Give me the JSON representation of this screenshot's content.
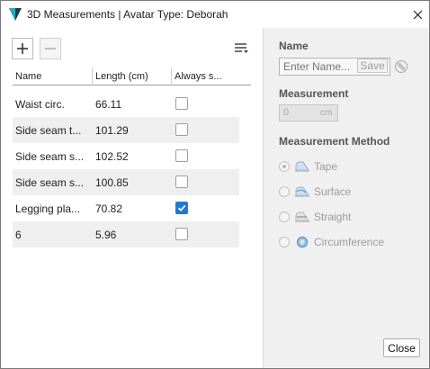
{
  "window": {
    "title": "3D Measurements | Avatar Type: Deborah"
  },
  "toolbar": {
    "add_icon": "plus-icon",
    "remove_icon": "minus-icon",
    "menu_icon": "list-menu-icon"
  },
  "table": {
    "columns": [
      "Name",
      "Length (cm)",
      "Always s..."
    ],
    "rows": [
      {
        "name": "Waist circ.",
        "length": "66.11",
        "always_show": false
      },
      {
        "name": "Side seam t...",
        "length": "101.29",
        "always_show": false
      },
      {
        "name": "Side seam s...",
        "length": "102.52",
        "always_show": false
      },
      {
        "name": "Side seam s...",
        "length": "100.85",
        "always_show": false
      },
      {
        "name": "Legging pla...",
        "length": "70.82",
        "always_show": true
      },
      {
        "name": "6",
        "length": "5.96",
        "always_show": false
      }
    ]
  },
  "details": {
    "name_label": "Name",
    "name_placeholder": "Enter Name...",
    "save_label": "Save",
    "measurement_label": "Measurement",
    "measurement_value": "0",
    "measurement_unit": "cm",
    "method_label": "Measurement Method",
    "methods": [
      {
        "label": "Tape",
        "icon": "tape-measure-icon",
        "selected": true
      },
      {
        "label": "Surface",
        "icon": "surface-measure-icon",
        "selected": false
      },
      {
        "label": "Straight",
        "icon": "straight-measure-icon",
        "selected": false
      },
      {
        "label": "Circumference",
        "icon": "circumference-icon",
        "selected": false
      }
    ]
  },
  "footer": {
    "close_label": "Close"
  },
  "colors": {
    "accent": "#1f79d1",
    "row_alt": "#efefef",
    "panel_bg": "#f0f0f0"
  }
}
